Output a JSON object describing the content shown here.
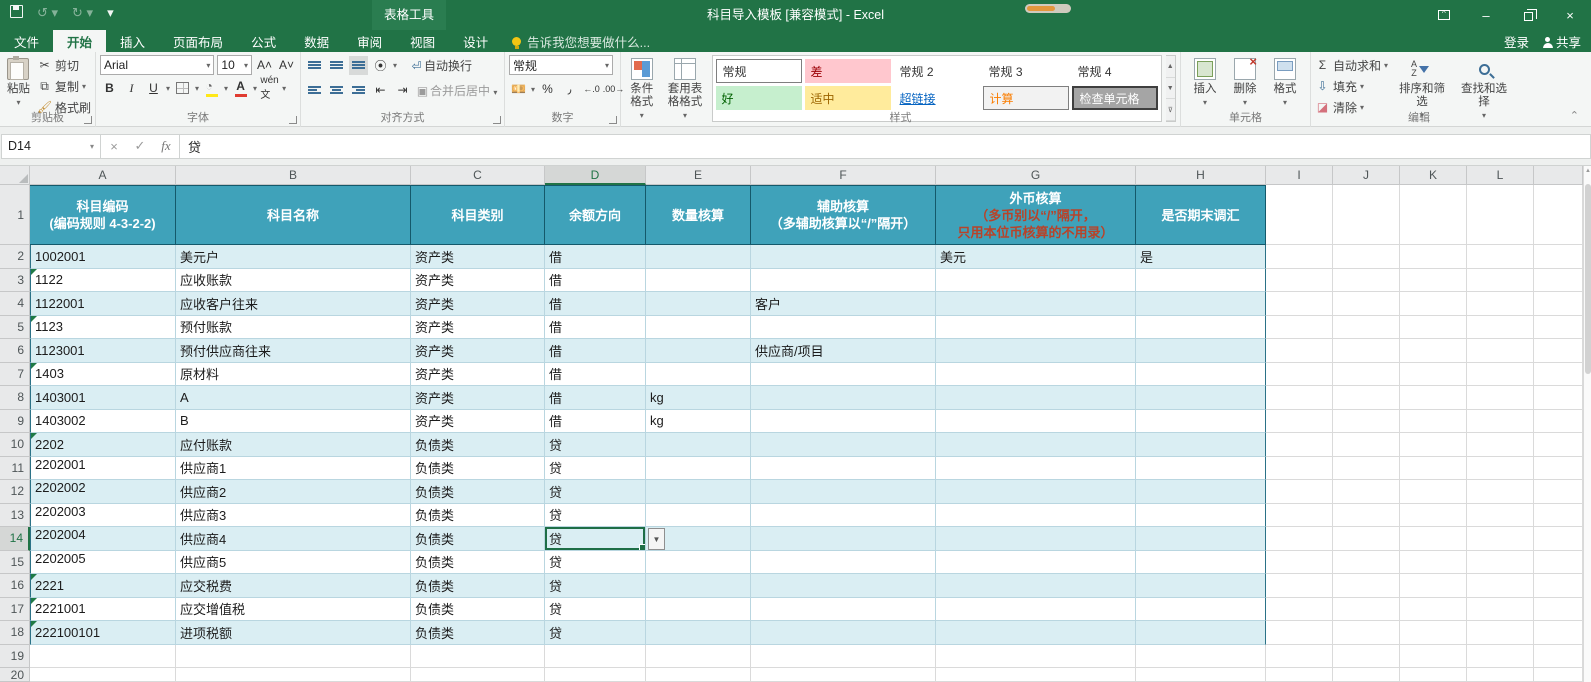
{
  "title_bar": {
    "title": "科目导入模板  [兼容模式] - Excel",
    "contextual_tab_group": "表格工具",
    "signin": "登录",
    "share": "共享"
  },
  "tabs": [
    {
      "label": "文件"
    },
    {
      "label": "开始"
    },
    {
      "label": "插入"
    },
    {
      "label": "页面布局"
    },
    {
      "label": "公式"
    },
    {
      "label": "数据"
    },
    {
      "label": "审阅"
    },
    {
      "label": "视图"
    },
    {
      "label": "设计"
    }
  ],
  "tellme": "告诉我您想要做什么...",
  "ribbon": {
    "clipboard": {
      "label": "剪贴板",
      "paste": "粘贴",
      "cut": "剪切",
      "copy": "复制",
      "format_painter": "格式刷"
    },
    "font": {
      "label": "字体",
      "family": "Arial",
      "size": "10",
      "bold": "B",
      "italic": "I",
      "underline": "U"
    },
    "alignment": {
      "label": "对齐方式",
      "wrap": "自动换行",
      "merge": "合并后居中"
    },
    "number": {
      "label": "数字",
      "format": "常规"
    },
    "styles": {
      "label": "样式",
      "conditional": "条件格式",
      "format_table": "套用表格格式",
      "items": [
        {
          "label": "常规"
        },
        {
          "label": "差"
        },
        {
          "label": "常规 2"
        },
        {
          "label": "常规 3"
        },
        {
          "label": "常规 4"
        },
        {
          "label": "好"
        },
        {
          "label": "适中"
        },
        {
          "label": "超链接"
        },
        {
          "label": "计算"
        },
        {
          "label": "检查单元格"
        }
      ]
    },
    "cells": {
      "label": "单元格",
      "insert": "插入",
      "delete": "删除",
      "format": "格式"
    },
    "editing": {
      "label": "编辑",
      "autosum": "自动求和",
      "fill": "填充",
      "clear": "清除",
      "sort": "排序和筛选",
      "find": "查找和选择"
    }
  },
  "formula_bar": {
    "name_box": "D14",
    "formula": "贷"
  },
  "grid": {
    "column_letters": [
      "A",
      "B",
      "C",
      "D",
      "E",
      "F",
      "G",
      "H",
      "I",
      "J",
      "K",
      "L",
      ""
    ],
    "selected": {
      "cell": "D14",
      "row": 14,
      "col_index": 3
    },
    "header": {
      "a1": [
        "科目编码",
        "(编码规则 4-3-2-2)"
      ],
      "b1": "科目名称",
      "c1": "科目类别",
      "d1": "余额方向",
      "e1": "数量核算",
      "f1": [
        "辅助核算",
        "（多辅助核算以“/”隔开）"
      ],
      "g1_white": "外币核算",
      "g1_red": [
        "（多币别以“/”隔开，",
        "只用本位币核算的不用录）"
      ],
      "h1": "是否期末调汇"
    },
    "rows": [
      {
        "n": 2,
        "cells": [
          "1002001",
          "美元户",
          "资产类",
          "借",
          "",
          "",
          "美元",
          "是"
        ]
      },
      {
        "n": 3,
        "cells": [
          "1122",
          "应收账款",
          "资产类",
          "借",
          "",
          "",
          "",
          ""
        ],
        "tri": true
      },
      {
        "n": 4,
        "cells": [
          "1122001",
          "应收客户往来",
          "资产类",
          "借",
          "",
          "客户",
          "",
          ""
        ]
      },
      {
        "n": 5,
        "cells": [
          "1123",
          "预付账款",
          "资产类",
          "借",
          "",
          "",
          "",
          ""
        ],
        "tri": true
      },
      {
        "n": 6,
        "cells": [
          "1123001",
          "预付供应商往来",
          "资产类",
          "借",
          "",
          "供应商/项目",
          "",
          ""
        ]
      },
      {
        "n": 7,
        "cells": [
          "1403",
          "原材料",
          "资产类",
          "借",
          "",
          "",
          "",
          ""
        ],
        "tri": true
      },
      {
        "n": 8,
        "cells": [
          "1403001",
          "A",
          "资产类",
          "借",
          "kg",
          "",
          "",
          ""
        ]
      },
      {
        "n": 9,
        "cells": [
          "1403002",
          "B",
          "资产类",
          "借",
          "kg",
          "",
          "",
          ""
        ]
      },
      {
        "n": 10,
        "cells": [
          "2202",
          "应付账款",
          "负债类",
          "贷",
          "",
          "",
          "",
          ""
        ],
        "tri": true
      },
      {
        "n": 11,
        "cells": [
          "2202001",
          "供应商1",
          "负债类",
          "贷",
          "",
          "",
          "",
          ""
        ],
        "top": true
      },
      {
        "n": 12,
        "cells": [
          "2202002",
          "供应商2",
          "负债类",
          "贷",
          "",
          "",
          "",
          ""
        ],
        "top": true
      },
      {
        "n": 13,
        "cells": [
          "2202003",
          "供应商3",
          "负债类",
          "贷",
          "",
          "",
          "",
          ""
        ],
        "top": true
      },
      {
        "n": 14,
        "cells": [
          "2202004",
          "供应商4",
          "负债类",
          "贷",
          "",
          "",
          "",
          ""
        ],
        "top": true
      },
      {
        "n": 15,
        "cells": [
          "2202005",
          "供应商5",
          "负债类",
          "贷",
          "",
          "",
          "",
          ""
        ],
        "top": true
      },
      {
        "n": 16,
        "cells": [
          "2221",
          "应交税费",
          "负债类",
          "贷",
          "",
          "",
          "",
          ""
        ],
        "tri": true
      },
      {
        "n": 17,
        "cells": [
          "2221001",
          "应交增值税",
          "负债类",
          "贷",
          "",
          "",
          "",
          ""
        ],
        "tri": true
      },
      {
        "n": 18,
        "cells": [
          "222100101",
          "进项税额",
          "负债类",
          "贷",
          "",
          "",
          "",
          ""
        ],
        "tri": true
      },
      {
        "n": 19,
        "cells": [
          "",
          "",
          "",
          "",
          "",
          "",
          "",
          ""
        ],
        "plain": true
      },
      {
        "n": 20,
        "cells": [
          "",
          "",
          "",
          "",
          "",
          "",
          "",
          ""
        ],
        "plain": true,
        "partial": true
      }
    ]
  },
  "colors": {
    "excel_green": "#217346",
    "table_header_teal": "#3fa2ba",
    "band_blue": "#daeef3",
    "header_red_text": "#b8432a",
    "style_bad_bg": "#ffc7ce",
    "style_bad_text": "#9c0006",
    "style_good_bg": "#c6efce",
    "style_good_text": "#006100",
    "style_neutral_bg": "#ffeb9c",
    "style_neutral_text": "#9c6500",
    "hyperlink": "#0563c1",
    "calc_text": "#fa7d00",
    "selection_green": "#1e6e46"
  }
}
